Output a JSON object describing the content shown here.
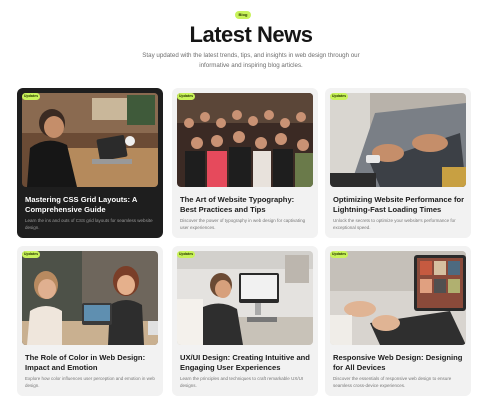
{
  "header": {
    "badge": "Blog",
    "title": "Latest News",
    "subtitle": "Stay updated with the latest trends, tips, and insights in web design through our informative and inspiring blog articles."
  },
  "posts": [
    {
      "tag": "Updates",
      "title": "Mastering CSS Grid Layouts: A Comprehensive Guide",
      "description": "Learn the ins and outs of CSS grid layouts for seamless website design."
    },
    {
      "tag": "Updates",
      "title": "The Art of Website Typography: Best Practices and Tips",
      "description": "Discover the power of typography in web design for captivating user experiences."
    },
    {
      "tag": "Updates",
      "title": "Optimizing Website Performance for Lightning-Fast Loading Times",
      "description": "Unlock the secrets to optimize your website's performance for exceptional speed."
    },
    {
      "tag": "Updates",
      "title": "The Role of Color in Web Design: Impact and Emotion",
      "description": "Explore how color influences user perception and emotion in web design."
    },
    {
      "tag": "Updates",
      "title": "UX/UI Design: Creating Intuitive and Engaging User Experiences",
      "description": "Learn the principles and techniques to craft remarkable UX/UI designs."
    },
    {
      "tag": "Updates",
      "title": "Responsive Web Design: Designing for All Devices",
      "description": "Discover the essentials of responsive web design to ensure seamless cross-device experiences."
    }
  ],
  "colors": {
    "accent": "#c8f25a",
    "card_background": "#f2f2f2",
    "featured_card_background": "#1e1e1e"
  }
}
